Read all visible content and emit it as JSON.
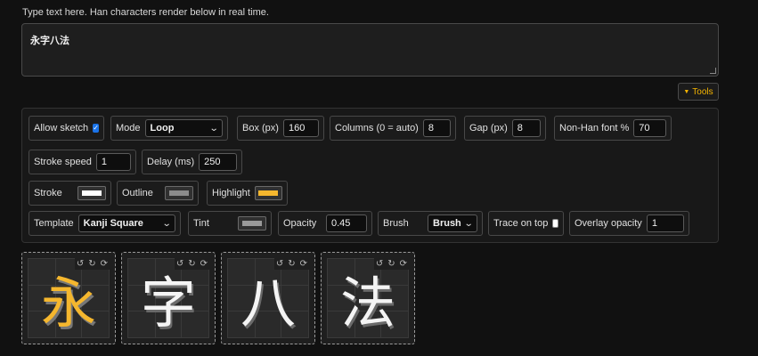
{
  "hint": "Type text here. Han characters render below in real time.",
  "input_text": "永字八法",
  "tools_label": "Tools",
  "controls": {
    "allow_sketch": {
      "label": "Allow sketch",
      "checked": true
    },
    "mode": {
      "label": "Mode",
      "value": "Loop"
    },
    "box": {
      "label": "Box (px)",
      "value": "160"
    },
    "columns": {
      "label": "Columns (0 = auto)",
      "value": "8"
    },
    "gap": {
      "label": "Gap (px)",
      "value": "8"
    },
    "nonhan": {
      "label": "Non-Han font %",
      "value": "70"
    },
    "stroke_speed": {
      "label": "Stroke speed",
      "value": "1"
    },
    "delay": {
      "label": "Delay (ms)",
      "value": "250"
    },
    "stroke": {
      "label": "Stroke",
      "color": "#ffffff"
    },
    "outline": {
      "label": "Outline",
      "color": "#8c8c8c"
    },
    "highlight": {
      "label": "Highlight",
      "color": "#f5b72e"
    },
    "template": {
      "label": "Template",
      "value": "Kanji Square"
    },
    "tint": {
      "label": "Tint",
      "color": "#9a9a9a"
    },
    "opacity": {
      "label": "Opacity",
      "value": "0.45"
    },
    "brush": {
      "label": "Brush",
      "value": "Brush"
    },
    "trace_on_top": {
      "label": "Trace on top",
      "checked": false
    },
    "overlay_opacity": {
      "label": "Overlay opacity",
      "value": "1"
    }
  },
  "tiles": [
    {
      "char": "永",
      "highlighted": true
    },
    {
      "char": "字",
      "highlighted": false
    },
    {
      "char": "八",
      "highlighted": false
    },
    {
      "char": "法",
      "highlighted": false
    }
  ],
  "tile_icons": [
    "undo-icon",
    "redo-icon",
    "replay-icon"
  ],
  "accent_color": "#f5b400"
}
